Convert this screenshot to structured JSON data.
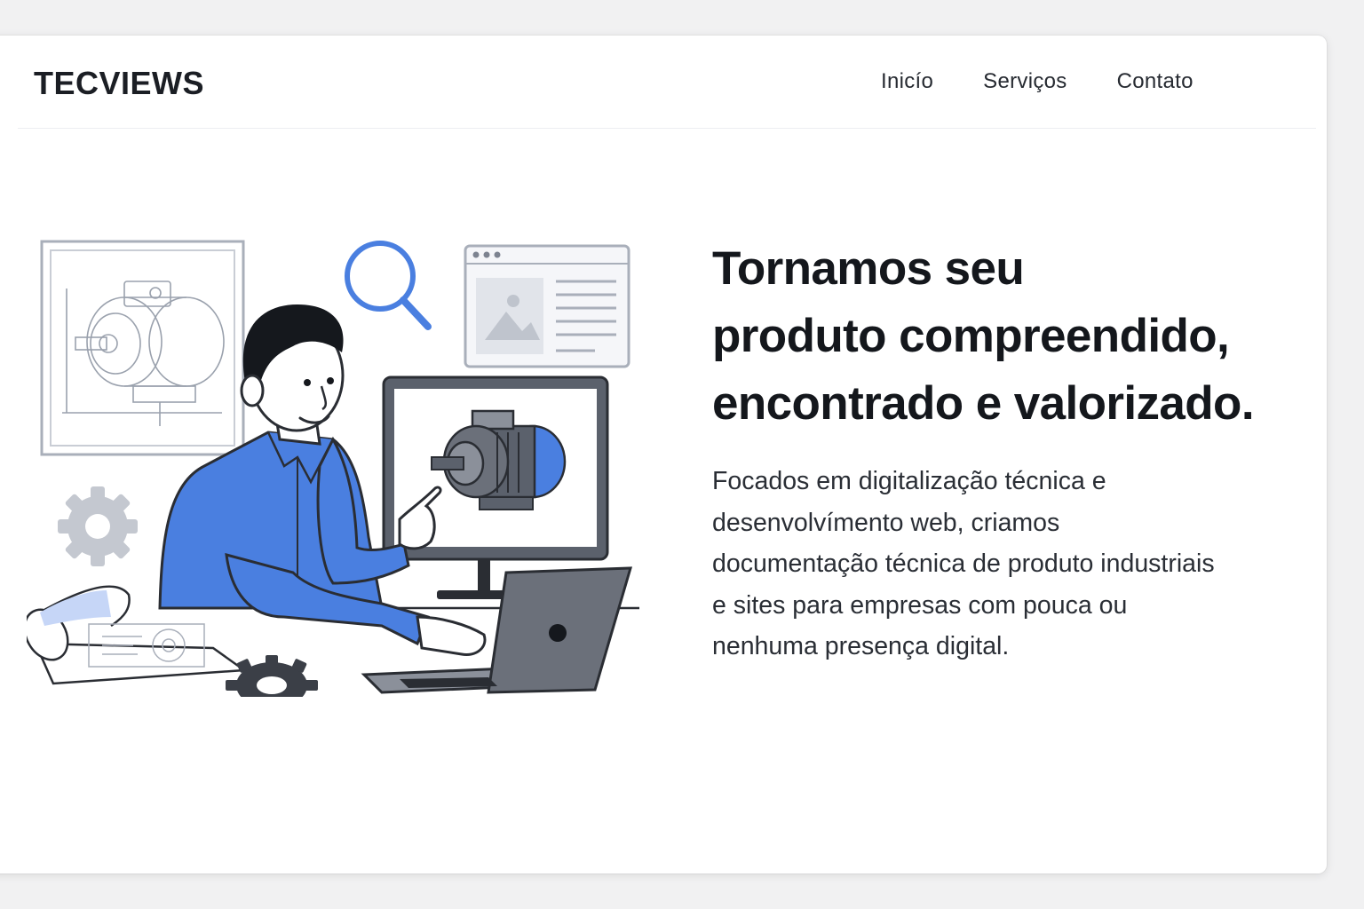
{
  "header": {
    "logo": "TECVIEWS",
    "nav": [
      {
        "label": "Inicío"
      },
      {
        "label": "Serviços"
      },
      {
        "label": "Contato"
      }
    ]
  },
  "hero": {
    "title_lines": [
      "Tornamos seu",
      "produto compreendido,",
      "encontrado e valorizado."
    ],
    "description_lines": [
      "Focados em digitalização técnica e",
      "desenvolvímento web, criamos",
      "documentação técnica de produto industriais",
      "e sites para empresas com pouca ou",
      "nenhuma presença digital."
    ]
  },
  "colors": {
    "accent_blue": "#4a7fe0",
    "dark_text": "#14171c",
    "line": "#2a2d33",
    "gray": "#6b6f78"
  }
}
